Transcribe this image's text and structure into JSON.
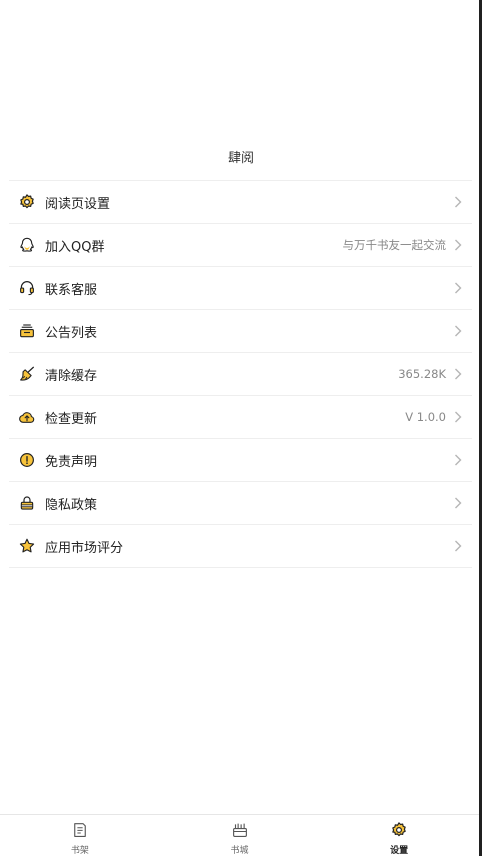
{
  "header": {
    "title": "肆阅"
  },
  "menu": [
    {
      "label": "阅读页设置",
      "value": "",
      "icon": "gear-icon"
    },
    {
      "label": "加入QQ群",
      "value": "与万千书友一起交流",
      "icon": "qq-penguin-icon"
    },
    {
      "label": "联系客服",
      "value": "",
      "icon": "headset-icon"
    },
    {
      "label": "公告列表",
      "value": "",
      "icon": "notice-tray-icon"
    },
    {
      "label": "清除缓存",
      "value": "365.28K",
      "icon": "broom-icon"
    },
    {
      "label": "检查更新",
      "value": "V 1.0.0",
      "icon": "cloud-upload-icon"
    },
    {
      "label": "免责声明",
      "value": "",
      "icon": "exclamation-circle-icon"
    },
    {
      "label": "隐私政策",
      "value": "",
      "icon": "lock-icon"
    },
    {
      "label": "应用市场评分",
      "value": "",
      "icon": "star-icon"
    }
  ],
  "tabbar": {
    "items": [
      {
        "label": "书架",
        "icon": "bookshelf-icon",
        "active": false
      },
      {
        "label": "书城",
        "icon": "bookstore-icon",
        "active": false
      },
      {
        "label": "设置",
        "icon": "settings-gear-icon",
        "active": true
      }
    ]
  },
  "colors": {
    "accent": "#F7C33B",
    "outline": "#222222",
    "divider": "#EEEEEE",
    "muted": "#888888"
  }
}
